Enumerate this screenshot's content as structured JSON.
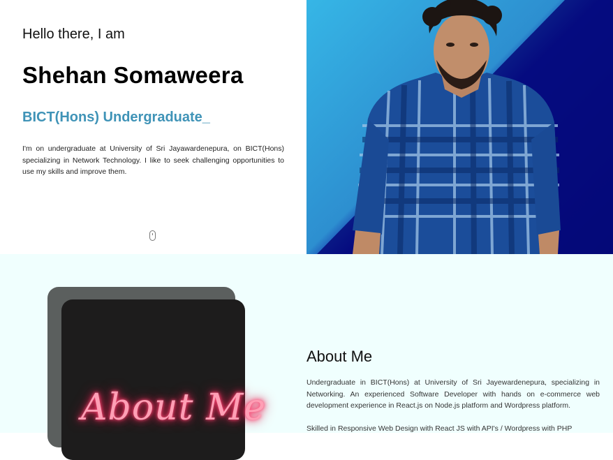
{
  "hero": {
    "greeting": "Hello there, I am",
    "name": "Shehan Somaweera",
    "role": "BICT(Hons) Undergraduate_",
    "intro": "I'm on undergraduate at University of Sri Jayawardenepura, on BICT(Hons) specializing in Network Technology. I like to seek challenging opportunities to use my skills and improve them.",
    "scroll_icon": "mouse-scroll-icon",
    "colors": {
      "accent": "#3f93b7",
      "gradient_light": "#36b6e6",
      "gradient_dark": "#04066b"
    }
  },
  "about": {
    "image_text": "About Me",
    "title": "About Me",
    "paragraph1": "Undergraduate in BICT(Hons) at University of Sri Jayewardenepura, specializing in Networking. An experienced Software Developer with hands on e-commerce web development experience in React.js on Node.js platform and Wordpress platform.",
    "paragraph2": "Skilled in Responsive Web Design with React JS with API's / Wordpress with PHP",
    "colors": {
      "background": "#f0fffe",
      "neon": "#ff4f7a"
    }
  }
}
